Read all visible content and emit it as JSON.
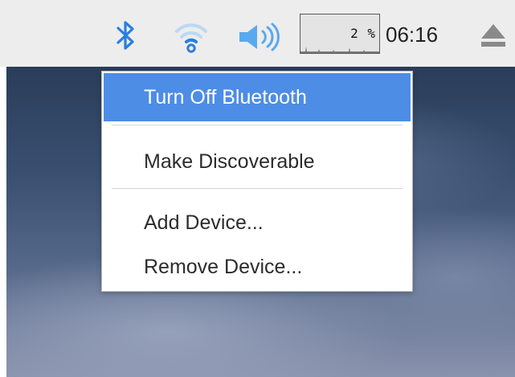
{
  "taskbar": {
    "icons": {
      "bluetooth": "bluetooth-icon",
      "wifi": "wifi-icon",
      "volume": "volume-icon",
      "eject": "eject-icon"
    },
    "cpu_monitor": {
      "usage_text": "2 %",
      "usage_percent": 2
    },
    "clock": "06:16"
  },
  "bluetooth_menu": {
    "items": [
      {
        "label": "Turn Off Bluetooth",
        "highlighted": true
      },
      {
        "label": "Make Discoverable",
        "highlighted": false
      },
      {
        "label": "Add Device...",
        "highlighted": false
      },
      {
        "label": "Remove Device...",
        "highlighted": false
      }
    ]
  },
  "colors": {
    "accent": "#4d8de6",
    "icon_blue": "#2a7fdc",
    "icon_light_blue": "#5aa9ee",
    "taskbar_bg": "#ededed"
  }
}
